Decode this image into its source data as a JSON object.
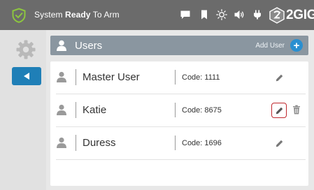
{
  "status": {
    "prefix": "System ",
    "bold": "Ready",
    "suffix": " To Arm"
  },
  "brand": {
    "name": "2GIG"
  },
  "header": {
    "title": "Users",
    "add_label": "Add User",
    "add_symbol": "+"
  },
  "users": [
    {
      "name": "Master User",
      "code": "Code: 1111",
      "edit_highlighted": false,
      "deletable": false
    },
    {
      "name": "Katie",
      "code": "Code: 8675",
      "edit_highlighted": true,
      "deletable": true
    },
    {
      "name": "Duress",
      "code": "Code: 1696",
      "edit_highlighted": false,
      "deletable": false
    }
  ],
  "colors": {
    "topbar": "#6b6b6b",
    "accent": "#1f7fb7",
    "header": "#8a96a0",
    "highlight": "#c0272d",
    "armed_ok": "#8dc63f"
  },
  "icons": [
    "shield-check-icon",
    "message-icon",
    "bookmark-icon",
    "brightness-icon",
    "volume-icon",
    "power-plug-icon",
    "gear-icon",
    "back-arrow-icon",
    "users-icon",
    "add-icon",
    "person-icon",
    "pencil-icon",
    "trash-icon"
  ]
}
